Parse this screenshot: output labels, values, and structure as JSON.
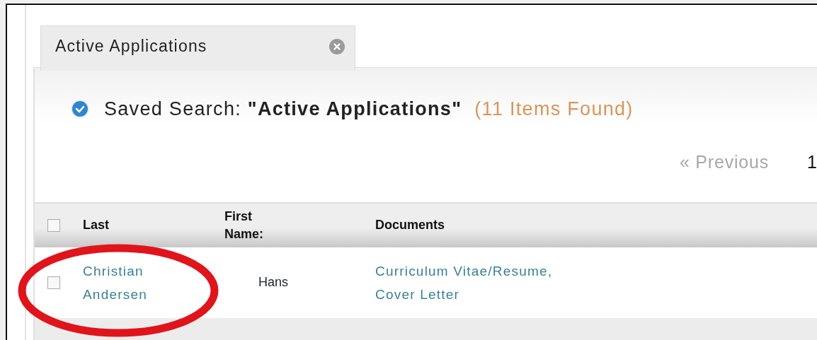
{
  "tabs": [
    {
      "label": "Active Applications",
      "selected": true
    }
  ],
  "search": {
    "checked": true,
    "prefix": "Saved Search: ",
    "name": "\"Active Applications\"",
    "count": "(11 Items Found)"
  },
  "pagination": {
    "previous": "« Previous",
    "pages": [
      "1"
    ]
  },
  "table": {
    "select_all": {
      "checked": false
    },
    "columns": [
      {
        "lines": [
          "Last"
        ]
      },
      {
        "lines": [
          "First",
          "Name:"
        ]
      },
      {
        "lines": [
          "Documents"
        ]
      }
    ],
    "rows": [
      {
        "checked": false,
        "last_name": [
          "Christian",
          "Andersen"
        ],
        "first_name": "Hans",
        "documents": [
          "Curriculum Vitae/Resume,",
          "Cover Letter"
        ]
      }
    ]
  }
}
